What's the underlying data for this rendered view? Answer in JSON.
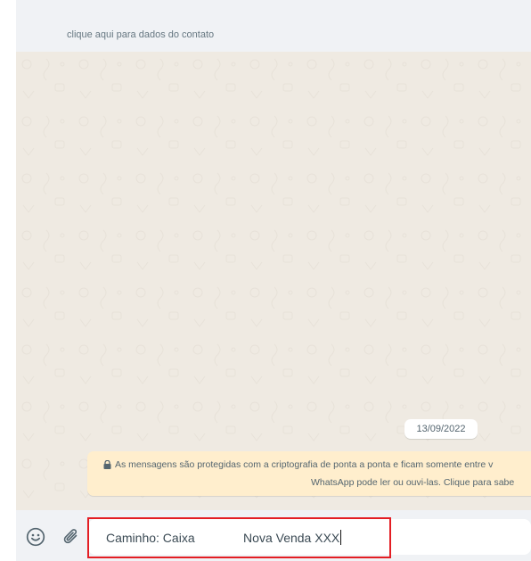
{
  "header": {
    "contact_hint": "clique aqui para dados do contato"
  },
  "chat": {
    "date_separator": "13/09/2022",
    "encryption_notice": {
      "icon": "lock-icon",
      "line1": "As mensagens são protegidas com a criptografia de ponta a ponta e ficam somente entre v",
      "line2": "WhatsApp pode ler ou ouvi-las. Clique para sabe"
    }
  },
  "composer": {
    "emoji_icon": "smiley-icon",
    "attach_icon": "paperclip-icon",
    "message_value": "Caminho: Caixa              Nova Venda XXX"
  },
  "colors": {
    "chat_background": "#efeae2",
    "panel_background": "#f0f2f5",
    "encryption_background": "#ffeecd",
    "highlight_border": "#e31e24"
  }
}
